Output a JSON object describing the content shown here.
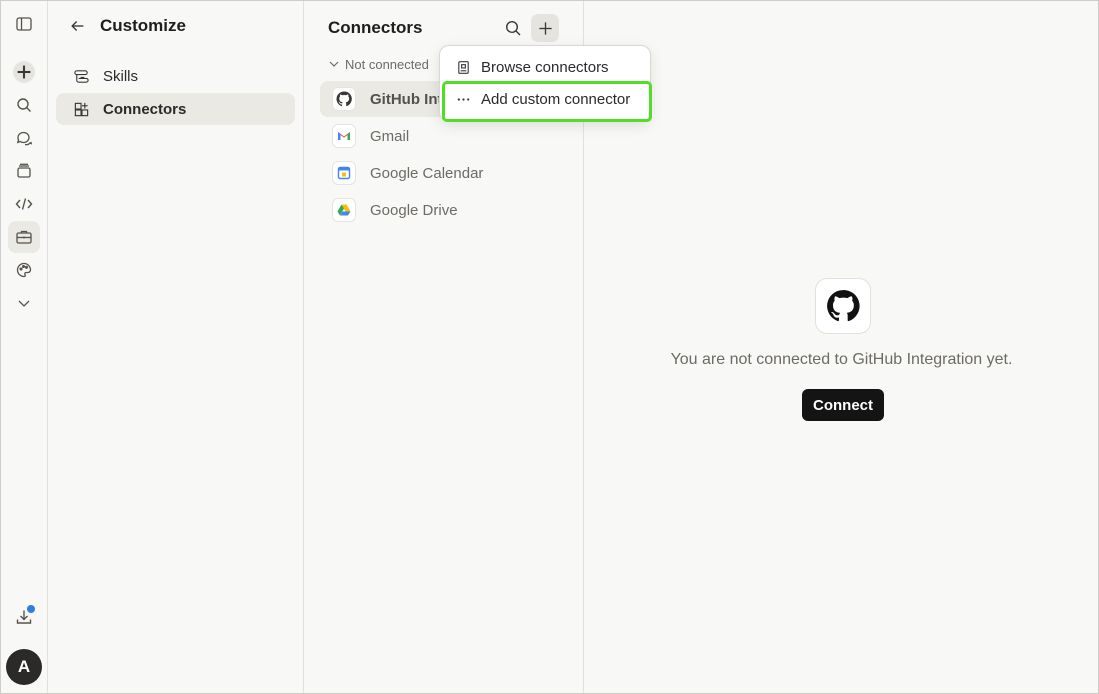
{
  "customize": {
    "title": "Customize",
    "nav": [
      {
        "label": "Skills"
      },
      {
        "label": "Connectors"
      }
    ]
  },
  "connectors": {
    "title": "Connectors",
    "section_label": "Not connected",
    "items": [
      {
        "label": "GitHub Integration",
        "display": "GitHub Int"
      },
      {
        "label": "Gmail"
      },
      {
        "label": "Google Calendar"
      },
      {
        "label": "Google Drive"
      }
    ]
  },
  "dropdown": {
    "items": [
      {
        "label": "Browse connectors",
        "icon": "book-icon"
      },
      {
        "label": "Add custom connector",
        "icon": "ellipsis-icon"
      }
    ]
  },
  "detail": {
    "message": "You are not connected to GitHub Integration yet.",
    "connect_label": "Connect"
  },
  "avatar": {
    "initial": "A"
  },
  "colors": {
    "highlight": "#4fe025",
    "notification_dot": "#2f7de1",
    "connect_button": "#141414"
  }
}
